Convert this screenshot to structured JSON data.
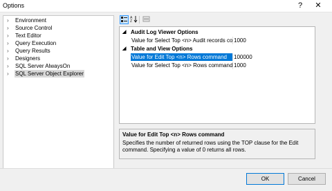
{
  "window": {
    "title": "Options",
    "help": "?",
    "close": "✕"
  },
  "tree": {
    "items": [
      {
        "label": "Environment"
      },
      {
        "label": "Source Control"
      },
      {
        "label": "Text Editor"
      },
      {
        "label": "Query Execution"
      },
      {
        "label": "Query Results"
      },
      {
        "label": "Designers"
      },
      {
        "label": "SQL Server AlwaysOn"
      },
      {
        "label": "SQL Server Object Explorer",
        "selected": true
      }
    ],
    "chevron": "›"
  },
  "toolbar": {
    "categorized_icon": "categorized-icon",
    "alphabetical_icon": "alphabetical-icon",
    "property_pages_icon": "property-pages-icon"
  },
  "grid": {
    "categories": [
      {
        "label": "Audit Log Viewer Options",
        "expand": "◢",
        "properties": [
          {
            "name": "Value for Select Top <n> Audit records cor",
            "value": "1000"
          }
        ]
      },
      {
        "label": "Table and View Options",
        "expand": "◢",
        "properties": [
          {
            "name": "Value for Edit Top <n> Rows command",
            "value": "100000",
            "selected": true
          },
          {
            "name": "Value for Select Top <n> Rows command",
            "value": "1000"
          }
        ]
      }
    ]
  },
  "description": {
    "title": "Value for Edit Top <n> Rows command",
    "text": "Specifies the number of returned rows using the TOP clause for the Edit command. Specifying a value of 0 returns all rows."
  },
  "buttons": {
    "ok": "OK",
    "cancel": "Cancel"
  }
}
